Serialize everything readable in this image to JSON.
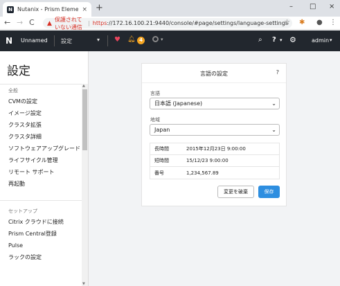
{
  "browser": {
    "tab_title": "Nutanix - Prism Element",
    "tab_favicon_letter": "N",
    "tab_close": "×",
    "new_tab": "+",
    "win_min": "–",
    "win_max": "□",
    "win_close": "×",
    "back": "←",
    "forward": "→",
    "reload": "C",
    "insecure_label": "保護されていない通信",
    "url_scheme": "https",
    "url_rest": "://172.16.100.21:9440/console/#page/settings/language-settings",
    "star": "☆",
    "ext1": "✱",
    "profile": "●",
    "menu": "⋮"
  },
  "appbar": {
    "logo": "N",
    "cluster_name": "Unnamed",
    "menu_label": "設定",
    "alert_count": "4",
    "user": "admin"
  },
  "sidebar": {
    "title": "設定",
    "section_general": "全般",
    "items_general": [
      "CVMの設定",
      "イメージ設定",
      "クラスタ拡張",
      "クラスタ詳細",
      "ソフトウェアアップグレード",
      "ライフサイクル管理",
      "リモート サポート",
      "再起動"
    ],
    "section_setup": "セットアップ",
    "items_setup": [
      "Citrix クラウドに接続",
      "Prism Central登録",
      "Pulse",
      "ラックの設定"
    ]
  },
  "dialog": {
    "title": "言語の設定",
    "help": "?",
    "language_label": "言語",
    "language_value": "日本語 (Japanese)",
    "region_label": "地域",
    "region_value": "Japan",
    "rows": [
      {
        "key": "長時間",
        "value": "2015年12月23日 9:00:00"
      },
      {
        "key": "短時間",
        "value": "15/12/23 9:00:00"
      },
      {
        "key": "番号",
        "value": "1,234,567.89"
      }
    ],
    "discard_label": "変更を破棄",
    "save_label": "保存"
  },
  "colors": {
    "appbar_bg": "#22272e",
    "save_button": "#2d8ee0",
    "alert": "#f5a623",
    "health": "#e8455d",
    "insecure": "#d93025"
  }
}
